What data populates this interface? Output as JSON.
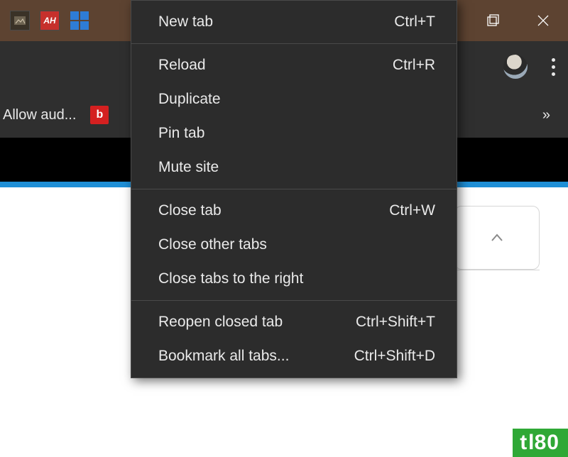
{
  "os_titlebar": {
    "taskicons": [
      "picture-app",
      "ah-app",
      "windows-app"
    ]
  },
  "browser": {
    "toolbar": {
      "menu_label": "Customize and control"
    },
    "bookmarks": {
      "first_label": "Allow aud...",
      "second_favicon_letter": "b",
      "overflow_label": "»"
    }
  },
  "context_menu": {
    "groups": [
      [
        {
          "label": "New tab",
          "shortcut": "Ctrl+T"
        }
      ],
      [
        {
          "label": "Reload",
          "shortcut": "Ctrl+R"
        },
        {
          "label": "Duplicate",
          "shortcut": ""
        },
        {
          "label": "Pin tab",
          "shortcut": ""
        },
        {
          "label": "Mute site",
          "shortcut": ""
        }
      ],
      [
        {
          "label": "Close tab",
          "shortcut": "Ctrl+W"
        },
        {
          "label": "Close other tabs",
          "shortcut": ""
        },
        {
          "label": "Close tabs to the right",
          "shortcut": ""
        }
      ],
      [
        {
          "label": "Reopen closed tab",
          "shortcut": "Ctrl+Shift+T"
        },
        {
          "label": "Bookmark all tabs...",
          "shortcut": "Ctrl+Shift+D"
        }
      ]
    ]
  },
  "watermark": {
    "text_raw": "tl80",
    "display_left": "t",
    "display_right": "80"
  }
}
